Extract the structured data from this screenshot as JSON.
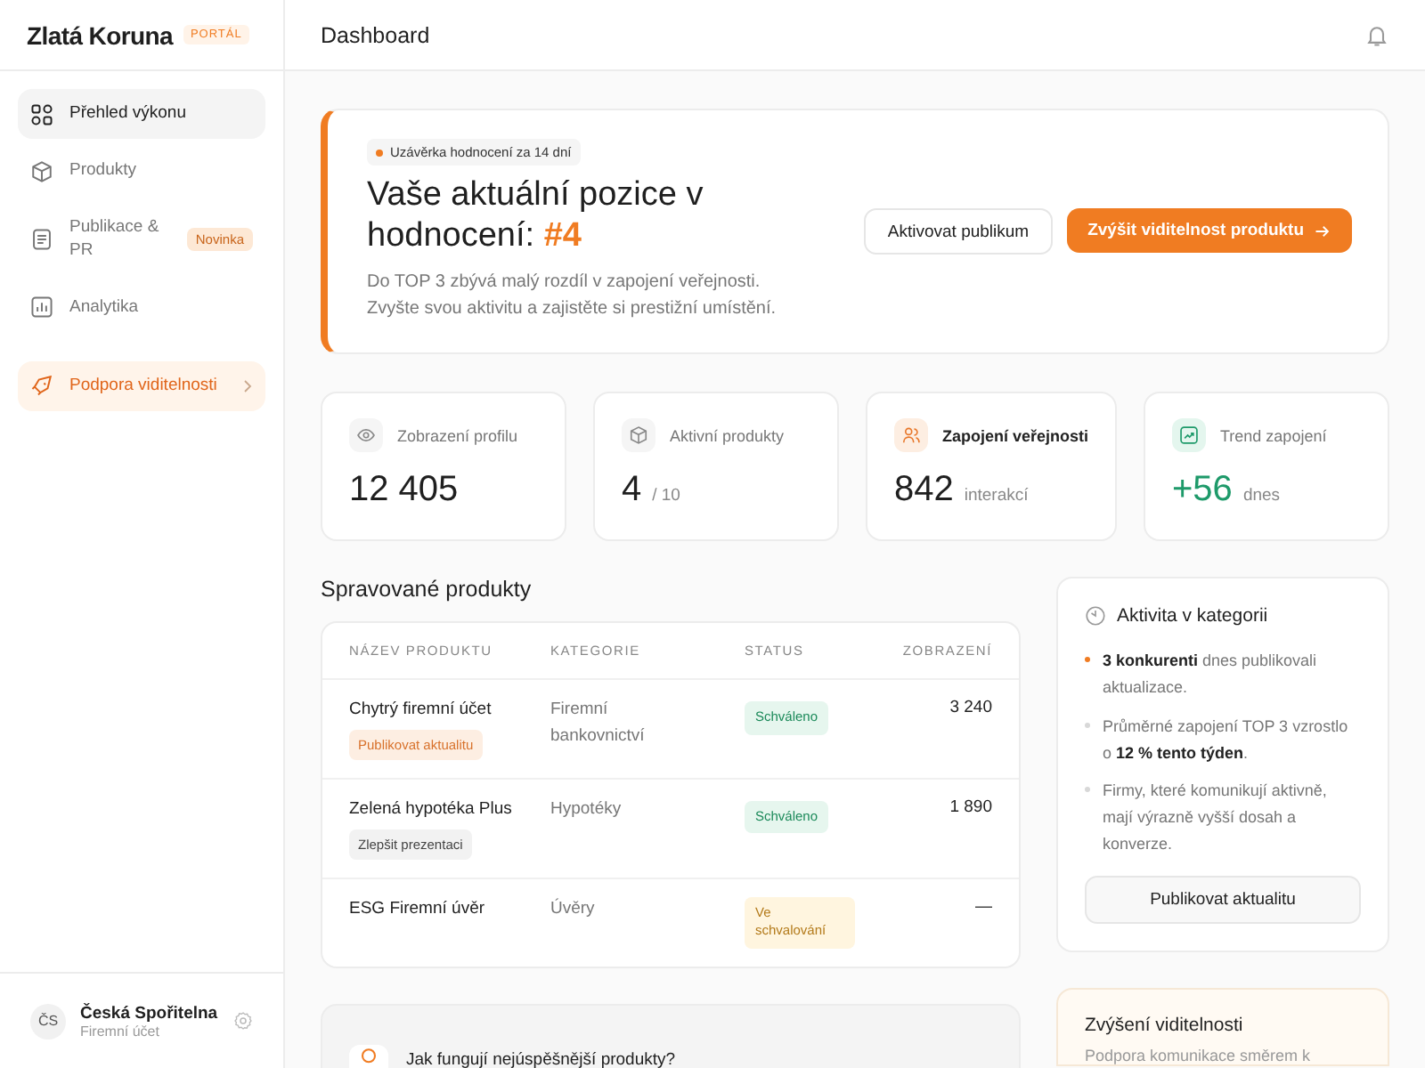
{
  "sidebar": {
    "brand": "Zlatá Koruna",
    "brand_tag": "PORTÁL",
    "items": [
      {
        "label": "Přehled výkonu",
        "selected": true,
        "kind": "nav"
      },
      {
        "label": "Produkty",
        "selected": false,
        "kind": "nav"
      },
      {
        "label": "Publikace & PR",
        "selected": false,
        "kind": "nav",
        "badge": "Novinka"
      },
      {
        "label": "Analytika",
        "selected": false,
        "kind": "nav"
      },
      {
        "label": "Podpora viditelnosti",
        "selected": false,
        "kind": "promo"
      }
    ],
    "account": {
      "initials": "ČS",
      "name": "Česká Spořitelna",
      "subtitle": "Firemní účet"
    }
  },
  "header": {
    "title": "Dashboard"
  },
  "hero": {
    "chip": "Uzávěrka hodnocení za 14 dní",
    "title": "Vaše aktuální pozice v hodnocení:",
    "rank": "#4",
    "lines": [
      "Do TOP 3 zbývá malý rozdíl v zapojení veřejnosti.",
      "Zvyšte svou aktivitu a zajistěte si prestižní umístění."
    ],
    "secondary_button": "Aktivovat publikum",
    "primary_button": "Zvýšit viditelnost produktu"
  },
  "stats": [
    {
      "label": "Zobrazení profilu",
      "value": "12 405",
      "kind": "neutral"
    },
    {
      "label": "Aktivní produkty",
      "value": "4",
      "unit": "/ 10",
      "kind": "neutral"
    },
    {
      "label": "Zapojení veřejnosti",
      "value": "842",
      "unit": "interakcí",
      "kind": "accent"
    },
    {
      "label": "Trend zapojení",
      "value": "+56",
      "unit": "dnes",
      "kind": "positive"
    }
  ],
  "products": {
    "title": "Spravované produkty",
    "columns": [
      "NÁZEV PRODUKTU",
      "KATEGORIE",
      "STATUS",
      "ZOBRAZENÍ"
    ],
    "rows": [
      {
        "name": "Chytrý firemní účet",
        "action": {
          "label": "Publikovat aktualitu",
          "kind": "primary"
        },
        "category": "Firemní bankovnictví",
        "status": {
          "label": "Schváleno",
          "kind": "approved"
        },
        "views": "3 240"
      },
      {
        "name": "Zelená hypotéka Plus",
        "action": {
          "label": "Zlepšit prezentaci",
          "kind": "neutral"
        },
        "category": "Hypotéky",
        "status": {
          "label": "Schváleno",
          "kind": "approved"
        },
        "views": "1 890"
      },
      {
        "name": "ESG Firemní úvěr",
        "category": "Úvěry",
        "status": {
          "label": "Ve schvalování",
          "kind": "pending"
        },
        "views": "—"
      }
    ]
  },
  "tip": {
    "title": "Jak fungují nejúspěšnější produkty?"
  },
  "activity": {
    "title": "Aktivita v kategorii",
    "items": [
      {
        "text": "**3 konkurenti** dnes publikovali aktualizace.",
        "highlighted": true
      },
      {
        "text": "Průměrné zapojení TOP 3 vzrostlo o **12 % tento týden**.",
        "highlighted": false
      },
      {
        "text": "Firmy, které komunikují aktivně, mají výrazně vyšší dosah a konverze.",
        "highlighted": false
      }
    ],
    "button": "Publikovat aktualitu"
  },
  "boost": {
    "title": "Zvýšení viditelnosti",
    "text": "Podpora komunikace směrem k"
  }
}
